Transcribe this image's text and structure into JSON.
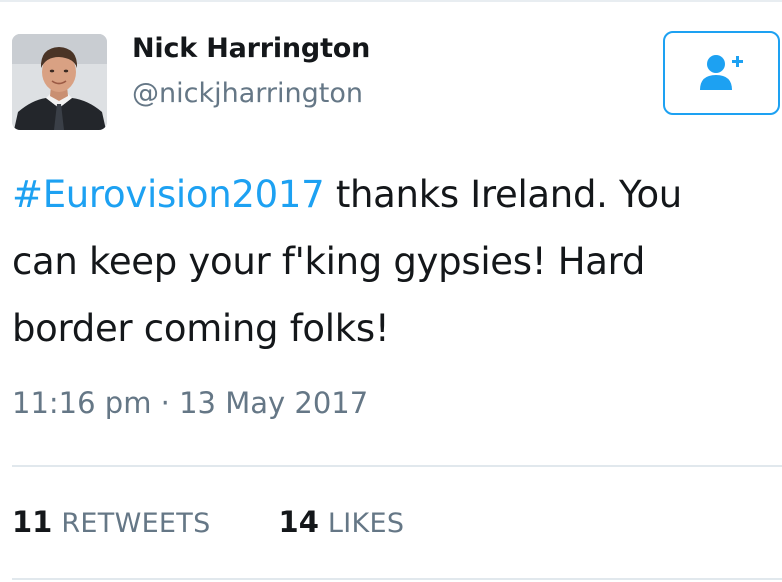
{
  "author": {
    "name": "Nick Harrington",
    "handle": "@nickjharrington"
  },
  "follow_button": {
    "icon": "follow-user-plus-icon",
    "color": "#1da1f2"
  },
  "tweet": {
    "hashtag": "#Eurovision2017",
    "text": " thanks Ireland. You can keep your f'king gypsies! Hard border coming folks!",
    "timestamp": "11:16 pm · 13 May 2017"
  },
  "stats": {
    "retweets_count": "11",
    "retweets_label": "RETWEETS",
    "likes_count": "14",
    "likes_label": "LIKES"
  },
  "colors": {
    "accent": "#1da1f2",
    "text": "#14171a",
    "secondary_text": "#657786",
    "divider": "#e1e8ed"
  }
}
